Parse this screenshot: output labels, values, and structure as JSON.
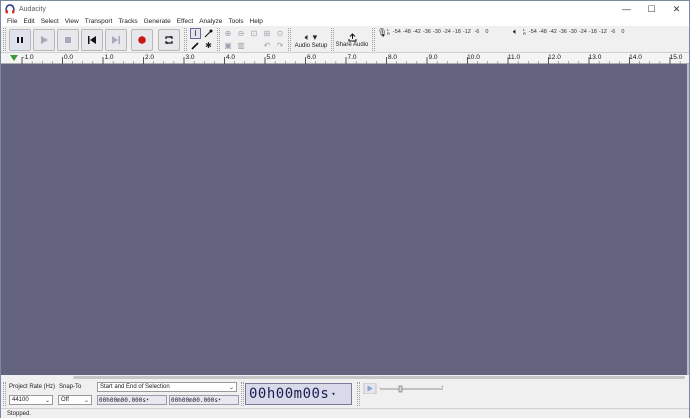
{
  "window": {
    "title": "Audacity",
    "minimize": "—",
    "maximize": "☐",
    "close": "✕"
  },
  "menu": [
    "File",
    "Edit",
    "Select",
    "View",
    "Transport",
    "Tracks",
    "Generate",
    "Effect",
    "Analyze",
    "Tools",
    "Help"
  ],
  "toolbar": {
    "audio_setup_label": "Audio Setup",
    "share_audio_label": "Share Audio",
    "record_meter_scale": [
      "-54",
      "-48",
      "-42",
      "-36",
      "-30",
      "-24",
      "-18",
      "-12",
      "-6",
      "0"
    ],
    "playback_meter_scale": [
      "-54",
      "-48",
      "-42",
      "-36",
      "-30",
      "-24",
      "-18",
      "-12",
      "-6",
      "0"
    ],
    "record_channel_l": "L",
    "record_channel_r": "R",
    "playback_channel_l": "L",
    "playback_channel_r": "R",
    "accent_color": "#d00000"
  },
  "ruler": {
    "ticks": [
      "-1.0",
      "0.0",
      "1.0",
      "2.0",
      "3.0",
      "4.0",
      "5.0",
      "6.0",
      "7.0",
      "8.0",
      "9.0",
      "10.0",
      "11.0",
      "12.0",
      "13.0",
      "14.0",
      "15.0"
    ]
  },
  "track_area": {
    "background": "#63637f"
  },
  "selection_toolbar": {
    "project_rate_label": "Project Rate (Hz)",
    "project_rate_value": "44100",
    "snap_to_label": "Snap-To",
    "snap_to_value": "Off",
    "selection_mode": "Start and End of Selection",
    "start_time": "00h00m00.000s",
    "end_time": "00h00m00.000s",
    "audio_position": "00h00m00s"
  },
  "status": {
    "text": "Stopped."
  }
}
